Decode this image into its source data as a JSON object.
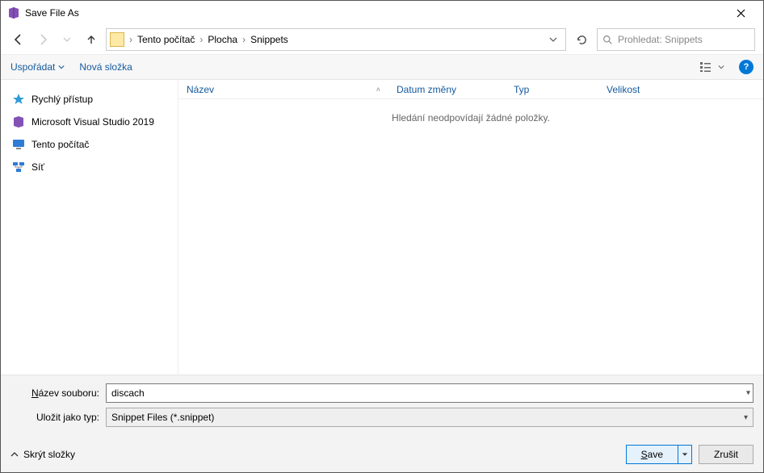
{
  "window": {
    "title": "Save File As"
  },
  "nav": {
    "breadcrumbs": [
      "Tento počítač",
      "Plocha",
      "Snippets"
    ],
    "search_placeholder": "Prohledat: Snippets"
  },
  "toolbar": {
    "organize": "Uspořádat",
    "new_folder": "Nová složka"
  },
  "sidebar": {
    "items": [
      {
        "label": "Rychlý přístup",
        "icon": "star"
      },
      {
        "label": "Microsoft Visual Studio 2019",
        "icon": "vs"
      },
      {
        "label": "Tento počítač",
        "icon": "monitor"
      },
      {
        "label": "Síť",
        "icon": "network"
      }
    ]
  },
  "columns": {
    "name": "Název",
    "date": "Datum změny",
    "type": "Typ",
    "size": "Velikost"
  },
  "filelist": {
    "empty_message": "Hledání neodpovídají žádné položky."
  },
  "form": {
    "filename_label_pre": "N",
    "filename_label_post": "ázev souboru:",
    "filename_value": "discach",
    "type_label": "Uložit jako typ:",
    "type_value": "Snippet Files (*.snippet)"
  },
  "footer": {
    "hide_folders": "Skrýt složky",
    "save_pre": "S",
    "save_post": "ave",
    "cancel": "Zrušit"
  }
}
